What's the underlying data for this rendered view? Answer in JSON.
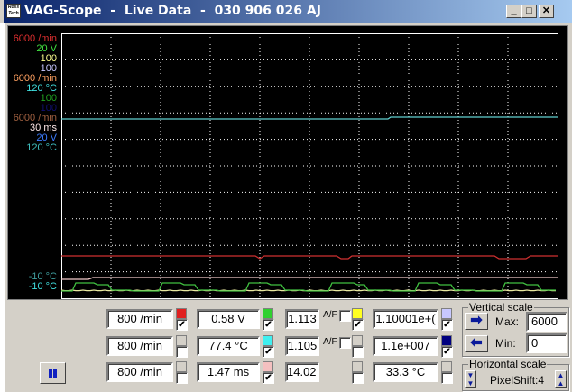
{
  "window": {
    "title": "VAG-Scope  -  Live Data  -  030 906 026 AJ",
    "icon_text": "Ross Tech",
    "minimize": "_",
    "maximize": "□",
    "close": "✕"
  },
  "colors": {
    "red": "#e02020",
    "green": "#30d030",
    "yellow": "#ffff20",
    "lavender": "#c8c8ff",
    "cyan": "#40f0f0",
    "navy": "#000080",
    "pink": "#f4c0c0",
    "grey": "#d4d0c8"
  },
  "scale_labels": [
    {
      "text": "6000 /min",
      "color": "#e03030"
    },
    {
      "text": "20 V",
      "color": "#40e040"
    },
    {
      "text": "100",
      "color": "#ffff90"
    },
    {
      "text": "100",
      "color": "#c8c8ff"
    },
    {
      "text": "6000 /min",
      "color": "#ffa060"
    },
    {
      "text": "120 °C",
      "color": "#40e0e0"
    },
    {
      "text": "100",
      "color": "#20a020"
    },
    {
      "text": "100",
      "color": "#101070"
    },
    {
      "text": "6000 /min",
      "color": "#a06040"
    },
    {
      "text": "30 ms",
      "color": "#ffe8e8"
    },
    {
      "text": "20 V",
      "color": "#3c7cff"
    },
    {
      "text": "120 °C",
      "color": "#40c0c0"
    }
  ],
  "min_labels": [
    {
      "text": "-10 °C",
      "color": "#40a0a0"
    },
    {
      "text": "-10 °C",
      "color": "#40e0e0"
    }
  ],
  "channels": [
    {
      "value": "800 /min",
      "swatch": "#e02020",
      "checked": true
    },
    {
      "value": "800 /min",
      "swatch": "#d4d0c8",
      "checked": false
    },
    {
      "value": "800 /min",
      "swatch": "#d4d0c8",
      "checked": false
    },
    {
      "value": "0.58 V",
      "swatch": "#30d030",
      "checked": true
    },
    {
      "value": "77.4 °C",
      "swatch": "#40f0f0",
      "checked": true
    },
    {
      "value": "1.47 ms",
      "swatch": "#f4c0c0",
      "checked": true
    },
    {
      "value": "1.113",
      "af": "A/F",
      "af_checked": false,
      "swatch": "#ffff20",
      "checked": true
    },
    {
      "value": "1.105",
      "af": "A/F",
      "af_checked": false,
      "swatch": "#d4d0c8",
      "checked": false
    },
    {
      "value": "14.02 V",
      "swatch": "#d4d0c8",
      "checked": false
    },
    {
      "value": "1.10001e+(",
      "swatch": "#c8c8ff",
      "checked": true
    },
    {
      "value": "1.1e+007",
      "swatch": "#000080",
      "checked": true
    },
    {
      "value": "33.3 °C",
      "swatch": "#d4d0c8",
      "checked": false
    }
  ],
  "vertical_scale": {
    "title": "Vertical scale",
    "max_label": "Max:",
    "max_value": "6000",
    "min_label": "Min:",
    "min_value": "0"
  },
  "horizontal_scale": {
    "title": "Horizontal scale",
    "pixelshift": "PixelShift:4"
  },
  "pause_button": "pause"
}
